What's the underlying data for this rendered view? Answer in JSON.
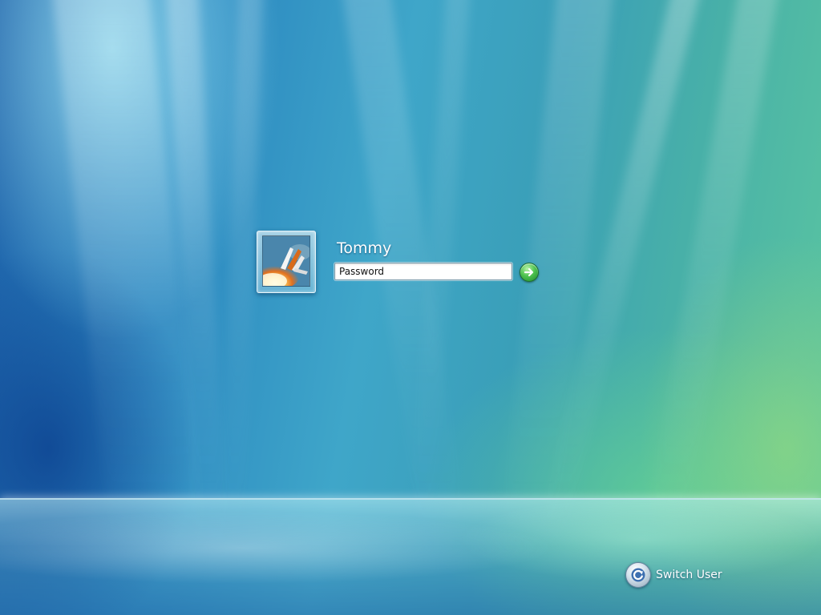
{
  "login": {
    "user_name": "Tommy",
    "password_placeholder": "Password",
    "password_value": "",
    "submit_icon": "arrow-right-icon",
    "avatar_icon": "space-shuttle-launch-avatar"
  },
  "footer": {
    "switch_user_label": "Switch User",
    "switch_user_icon": "switch-user-arrow-icon"
  },
  "colors": {
    "submit_green": "#3fb548",
    "text_white": "#ffffff",
    "background_blue": "#2a86c0",
    "background_green": "#5cc7a0"
  }
}
